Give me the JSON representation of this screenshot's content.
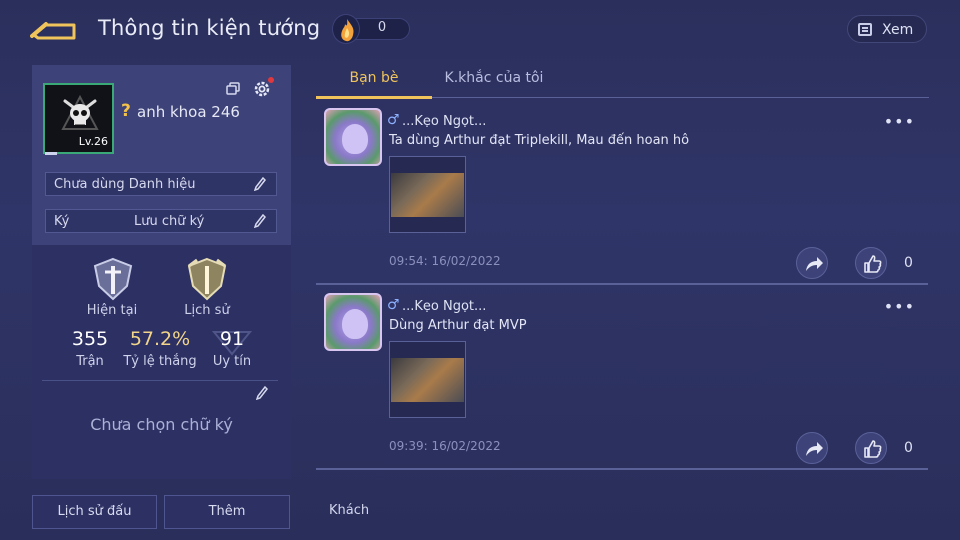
{
  "header": {
    "title": "Thông tin kiện tướng",
    "currency_value": "0",
    "view_label": "Xem"
  },
  "profile": {
    "level": "Lv.26",
    "name_prefix": "?",
    "name": "anh khoa 246",
    "title_field": "Chưa dùng Danh hiệu",
    "sign_label": "Ký",
    "sign_value": "Lưu chữ ký"
  },
  "stats": {
    "current_label": "Hiện tại",
    "history_label": "Lịch sử",
    "matches": {
      "value": "355",
      "label": "Trận"
    },
    "win_rate": {
      "value": "57.2%",
      "label": "Tỷ lệ thắng"
    },
    "reputation": {
      "value": "91",
      "label": "Uy tín"
    },
    "signature_placeholder": "Chưa chọn chữ ký"
  },
  "buttons": {
    "history": "Lịch sử đấu",
    "more": "Thêm"
  },
  "tabs": [
    {
      "label": "Bạn bè",
      "active": true
    },
    {
      "label": "K.khắc của tôi",
      "active": false
    }
  ],
  "posts": [
    {
      "gender": "♂",
      "author": "...Kẹo Ngọt...",
      "text": "Ta dùng Arthur đạt Triplekill, Mau đến hoan hô",
      "menu": "•••",
      "time": "09:54: 16/02/2022",
      "likes": "0"
    },
    {
      "gender": "♂",
      "author": "...Kẹo Ngọt...",
      "text": "Dùng Arthur đạt MVP",
      "menu": "•••",
      "time": "09:39: 16/02/2022",
      "likes": "0"
    }
  ],
  "footer": {
    "guest_label": "Khách"
  },
  "colors": {
    "accent": "#f0c45b",
    "panel": "#3d4378",
    "background": "#2f3568",
    "badge_red": "#e0383d",
    "frame_green": "#3aa877"
  },
  "icons": {
    "back": "back-arrow-icon",
    "currency": "flame-icon",
    "view": "list-icon",
    "copy": "copy-icon",
    "settings": "gear-icon",
    "edit": "pencil-icon",
    "share": "share-icon",
    "like": "thumbs-up-icon"
  }
}
